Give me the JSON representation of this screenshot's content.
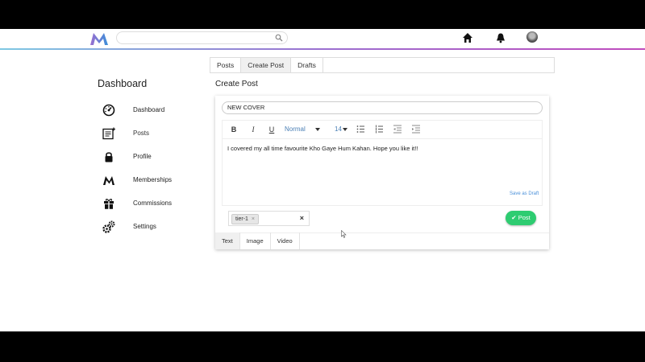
{
  "header": {
    "search_placeholder": "",
    "icons": [
      "logo-m",
      "search-icon",
      "home-icon",
      "bell-icon",
      "avatar"
    ]
  },
  "tabs": [
    {
      "label": "Posts",
      "active": false
    },
    {
      "label": "Create Post",
      "active": true
    },
    {
      "label": "Drafts",
      "active": false
    }
  ],
  "sidebar": {
    "title": "Dashboard",
    "items": [
      {
        "label": "Dashboard",
        "icon": "gauge-icon"
      },
      {
        "label": "Posts",
        "icon": "posts-icon",
        "active": true
      },
      {
        "label": "Profile",
        "icon": "lock-icon"
      },
      {
        "label": "Memberships",
        "icon": "m-logo-icon"
      },
      {
        "label": "Commissions",
        "icon": "gift-icon"
      },
      {
        "label": "Settings",
        "icon": "gears-icon"
      }
    ]
  },
  "create_post": {
    "title": "Create Post",
    "title_value": "NEW COVER",
    "toolbar": {
      "bold": "B",
      "italic": "I",
      "underline": "U",
      "format": "Normal",
      "size": "14"
    },
    "content": "I covered my all time favourite Kho Gaye Hum Kahan. Hope you like it!!",
    "save_draft": "Save as Draft",
    "tag": "tier-1",
    "tag_remove": "×",
    "clear": "×",
    "post_label": "Post",
    "post_check": "✔",
    "bottom_tabs": [
      {
        "label": "Text",
        "active": true
      },
      {
        "label": "Image",
        "active": false
      },
      {
        "label": "Video",
        "active": false
      }
    ]
  },
  "colors": {
    "accent_green": "#2ecc71",
    "link_blue": "#4a90d9",
    "brand_gradient": [
      "#7ec8e3",
      "#9b6fd0",
      "#c04bbd"
    ]
  }
}
